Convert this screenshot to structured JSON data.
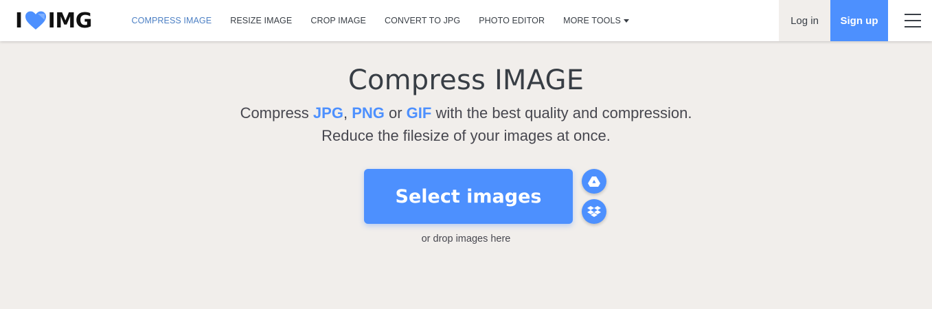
{
  "header": {
    "logo": {
      "prefix": "I",
      "suffix": "IMG"
    },
    "nav": [
      {
        "label": "COMPRESS IMAGE",
        "active": true
      },
      {
        "label": "RESIZE IMAGE",
        "active": false
      },
      {
        "label": "CROP IMAGE",
        "active": false
      },
      {
        "label": "CONVERT TO JPG",
        "active": false
      },
      {
        "label": "PHOTO EDITOR",
        "active": false
      },
      {
        "label": "MORE TOOLS",
        "active": false
      }
    ],
    "login_label": "Log in",
    "signup_label": "Sign up",
    "menu_icon": "hamburger-icon"
  },
  "main": {
    "title": "Compress IMAGE",
    "subtitle": {
      "pre": "Compress ",
      "format1": "JPG",
      "sep1": ", ",
      "format2": "PNG",
      "sep2": " or ",
      "format3": "GIF",
      "post": " with the best quality and compression.",
      "line2": "Reduce the filesize of your images at once."
    },
    "select_label": "Select images",
    "drop_hint": "or drop images here",
    "cloud_icons": [
      "google-drive-icon",
      "dropbox-icon"
    ]
  },
  "colors": {
    "accent": "#4d90fe",
    "active_nav": "#4d80c4",
    "background": "#f1eeeb",
    "text": "#383e45"
  }
}
